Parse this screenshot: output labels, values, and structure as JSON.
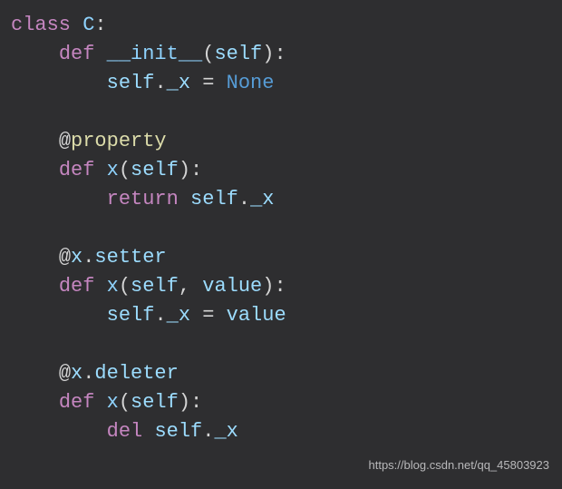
{
  "tokens": {
    "class_kw": "class",
    "class_name": "C",
    "def_kw": "def",
    "init_name": "__init__",
    "self_param": "self",
    "value_param": "value",
    "attr_x": "_x",
    "none_kw": "None",
    "at": "@",
    "property_dec": "property",
    "x_name": "x",
    "setter": "setter",
    "deleter": "deleter",
    "return_kw": "return",
    "del_kw": "del",
    "colon": ":",
    "lparen": "(",
    "rparen": ")",
    "assign": " = ",
    "dot": ".",
    "comma": ", "
  },
  "watermark": "https://blog.csdn.net/qq_45803923"
}
